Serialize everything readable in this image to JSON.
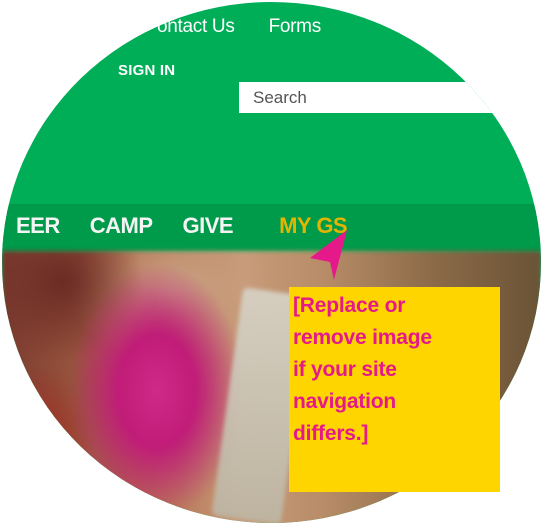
{
  "header": {
    "top_links": [
      "ontact Us",
      "Forms"
    ],
    "sign_in": "SIGN IN",
    "search": {
      "placeholder": "Search",
      "value": ""
    }
  },
  "nav": {
    "items": [
      "EER",
      "CAMP",
      "GIVE"
    ],
    "active_item": "MY GS"
  },
  "callout": {
    "lines": [
      "[Replace or",
      "remove image",
      "if your site",
      "navigation",
      "differs.]"
    ]
  },
  "colors": {
    "brand_green": "#00ae58",
    "nav_green": "#009a4b",
    "active_gold": "#e3b500",
    "callout_bg": "#ffd500",
    "callout_text": "#e5198a"
  }
}
